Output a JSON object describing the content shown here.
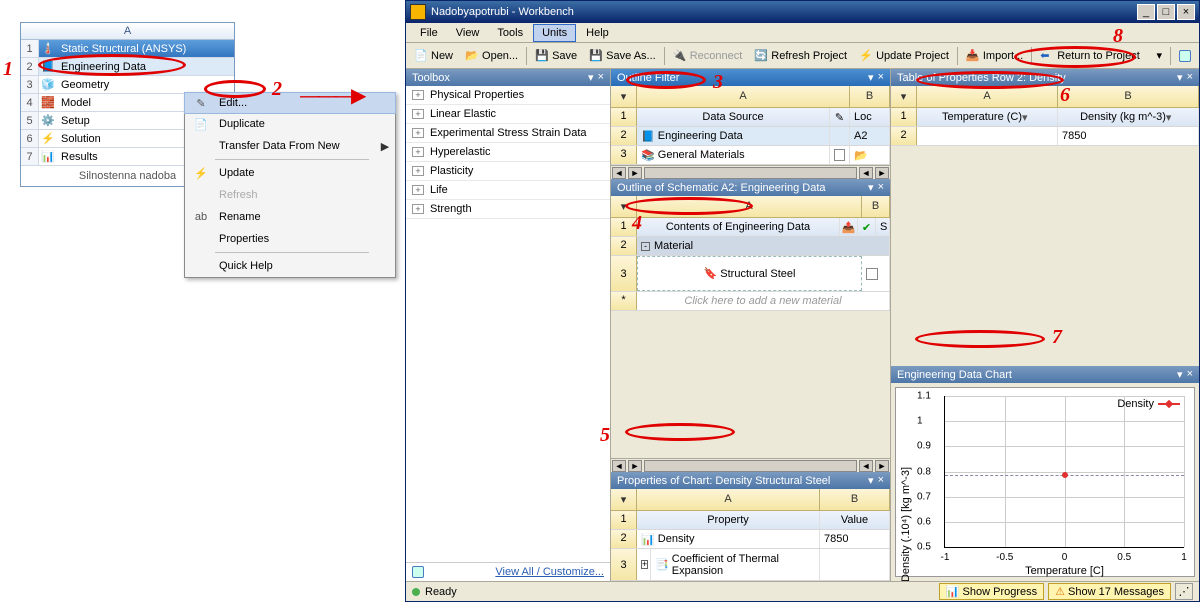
{
  "window_title": "Nadobyapotrubi - Workbench",
  "schematic": {
    "header": "A",
    "rows": [
      {
        "n": "1",
        "label": "Static Structural (ANSYS)",
        "icon": "🌡️"
      },
      {
        "n": "2",
        "label": "Engineering Data",
        "icon": "📘"
      },
      {
        "n": "3",
        "label": "Geometry",
        "icon": "🧊"
      },
      {
        "n": "4",
        "label": "Model",
        "icon": "🧱"
      },
      {
        "n": "5",
        "label": "Setup",
        "icon": "⚙️"
      },
      {
        "n": "6",
        "label": "Solution",
        "icon": "⚡"
      },
      {
        "n": "7",
        "label": "Results",
        "icon": "📊"
      }
    ],
    "footer": "Silnostenna nadoba"
  },
  "context": {
    "items": [
      {
        "label": "Edit...",
        "icon": "✎",
        "sel": true
      },
      {
        "label": "Duplicate",
        "icon": "📄"
      },
      {
        "label": "Transfer Data From New",
        "arrow": true
      },
      {
        "sep": true
      },
      {
        "label": "Update",
        "icon": "⚡"
      },
      {
        "label": "Refresh",
        "disabled": true
      },
      {
        "label": "Rename",
        "icon": "ab"
      },
      {
        "label": "Properties"
      },
      {
        "sep": true
      },
      {
        "label": "Quick Help"
      }
    ]
  },
  "menus": [
    "File",
    "View",
    "Tools",
    "Units",
    "Help"
  ],
  "menu_selected": "Units",
  "toolbar": {
    "new": "New",
    "open": "Open...",
    "save": "Save",
    "saveas": "Save As...",
    "reconnect": "Reconnect",
    "refresh": "Refresh Project",
    "update": "Update Project",
    "import": "Import...",
    "return": "Return to Project"
  },
  "toolbox": {
    "title": "Toolbox",
    "items": [
      "Physical Properties",
      "Linear Elastic",
      "Experimental Stress Strain Data",
      "Hyperelastic",
      "Plasticity",
      "Life",
      "Strength"
    ],
    "footer": "View All / Customize..."
  },
  "outline_filter": {
    "title": "Outline Filter",
    "col_a": "A",
    "col_b": "B",
    "rows": [
      {
        "n": "1",
        "a": "Data Source",
        "b": "Loc",
        "icon": "✎",
        "hdr": true
      },
      {
        "n": "2",
        "a": "Engineering Data",
        "b": "A2",
        "icon": "📘"
      },
      {
        "n": "3",
        "a": "General Materials",
        "b": "",
        "icon": "📚",
        "chk": true
      }
    ]
  },
  "outline_schem": {
    "title": "Outline of Schematic A2: Engineering Data",
    "col_a": "A",
    "col_b": "B",
    "rows": [
      {
        "n": "1",
        "a": "Contents of Engineering Data",
        "hdr": true
      },
      {
        "n": "2",
        "a": "Material",
        "minus": true,
        "bold": true
      },
      {
        "n": "3",
        "a": "Structural Steel",
        "icon": "🔖",
        "chk": true
      },
      {
        "n": "*",
        "a": "Click here to add a new material",
        "hint": true
      }
    ]
  },
  "propchart": {
    "title": "Properties of Chart: Density Structural Steel",
    "col_a": "A",
    "col_b": "B",
    "h_a": "Property",
    "h_b": "Value",
    "rows": [
      {
        "n": "2",
        "a": "Density",
        "b": "7850",
        "icon": "📊"
      },
      {
        "n": "3",
        "a": "Coefficient of Thermal Expansion",
        "b": "",
        "icon": "📑",
        "exp": true
      }
    ]
  },
  "proptable": {
    "title": "Table of Properties Row 2: Density",
    "col_a": "A",
    "col_b": "B",
    "h_a": "Temperature (C)",
    "h_b": "Density (kg m^-3)",
    "rows": [
      {
        "n": "2",
        "a": "",
        "b": "7850"
      }
    ]
  },
  "datachart": {
    "title": "Engineering Data Chart"
  },
  "chart_data": {
    "type": "scatter",
    "title": "",
    "xlabel": "Temperature  [C]",
    "ylabel": "Density  (.10⁴)  [kg m^-3]",
    "xlim": [
      -1,
      1
    ],
    "ylim": [
      0.5,
      1.1
    ],
    "xticks": [
      -1,
      -0.5,
      0,
      0.5,
      1
    ],
    "yticks": [
      0.5,
      0.6,
      0.7,
      0.8,
      0.9,
      1,
      1.1
    ],
    "series": [
      {
        "name": "Density",
        "x": [
          0
        ],
        "y": [
          0.785
        ]
      }
    ]
  },
  "status": {
    "ready": "Ready",
    "progress": "Show Progress",
    "messages": "Show 17 Messages"
  },
  "annotations": {
    "1": "1",
    "2": "2",
    "3": "3",
    "4": "4",
    "5": "5",
    "6": "6",
    "7": "7",
    "8": "8"
  }
}
